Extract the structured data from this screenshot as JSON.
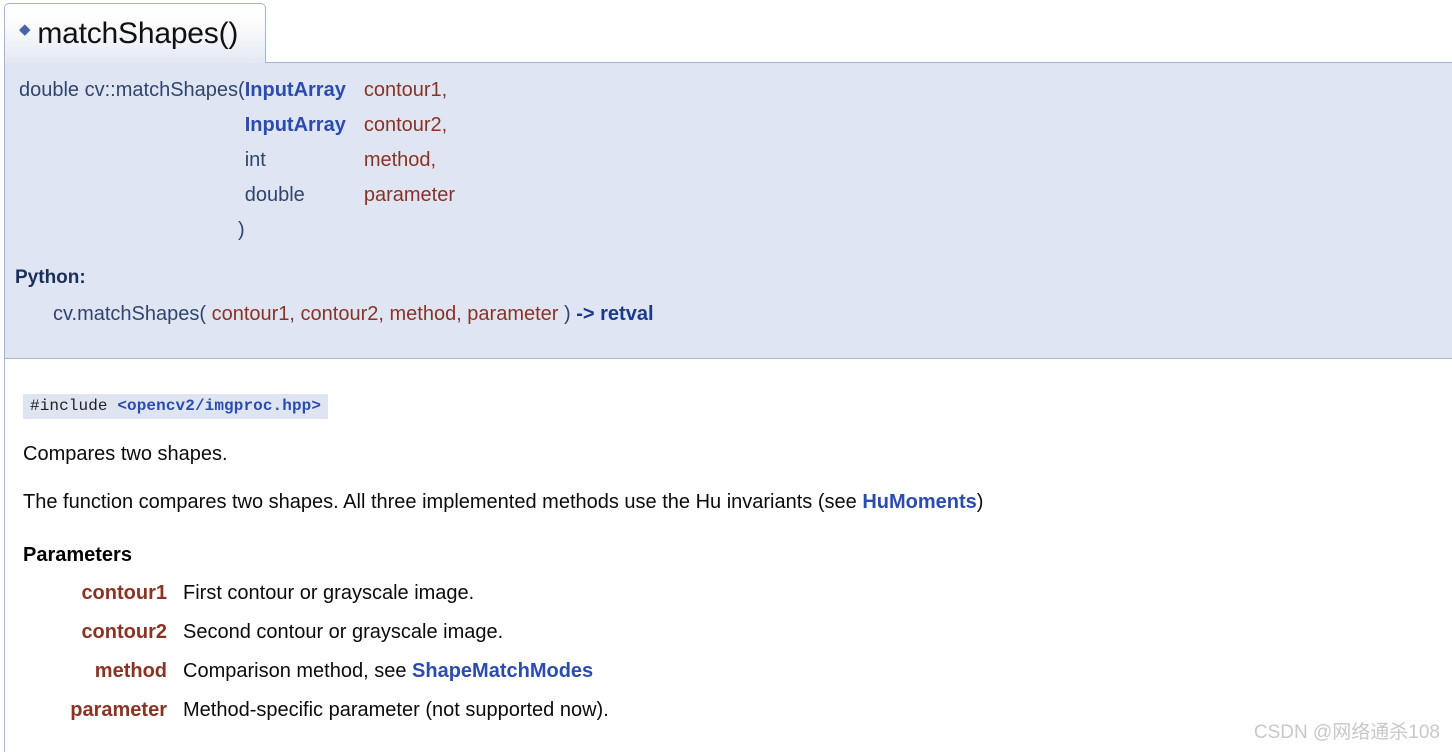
{
  "header": {
    "permalink_glyph": "◆",
    "title": "matchShapes()"
  },
  "signature": {
    "return_and_name": "double cv::matchShapes",
    "open_paren": "(",
    "close_paren": ")",
    "rows": [
      {
        "type": "InputArray",
        "type_is_link": true,
        "name": "contour1,"
      },
      {
        "type": "InputArray",
        "type_is_link": true,
        "name": "contour2,"
      },
      {
        "type": "int",
        "type_is_link": false,
        "name": "method,"
      },
      {
        "type": "double",
        "type_is_link": false,
        "name": "parameter"
      }
    ]
  },
  "python": {
    "label": "Python:",
    "call_prefix": "cv.matchShapes(",
    "args": " contour1, contour2, method, parameter ",
    "call_suffix": ")",
    "returns": " -> retval"
  },
  "include": {
    "directive": "#include ",
    "path": "<opencv2/imgproc.hpp>"
  },
  "brief": "Compares two shapes.",
  "detail": {
    "before_link": "The function compares two shapes. All three implemented methods use the Hu invariants (see ",
    "link": "HuMoments",
    "after_link": ")"
  },
  "parameters_heading": "Parameters",
  "parameters": [
    {
      "name": "contour1",
      "desc": "First contour or grayscale image.",
      "link": ""
    },
    {
      "name": "contour2",
      "desc": "Second contour or grayscale image.",
      "link": ""
    },
    {
      "name": "method",
      "desc": "Comparison method, see ",
      "link": "ShapeMatchModes"
    },
    {
      "name": "parameter",
      "desc": "Method-specific parameter (not supported now).",
      "link": ""
    }
  ],
  "watermark": "CSDN @网络通杀108",
  "colors": {
    "link_blue": "#2a4bb0",
    "param_brown": "#8a3324",
    "sig_navy": "#30456e",
    "proto_bg": "#dfe5f2",
    "border_blue": "#a3b4d4"
  }
}
